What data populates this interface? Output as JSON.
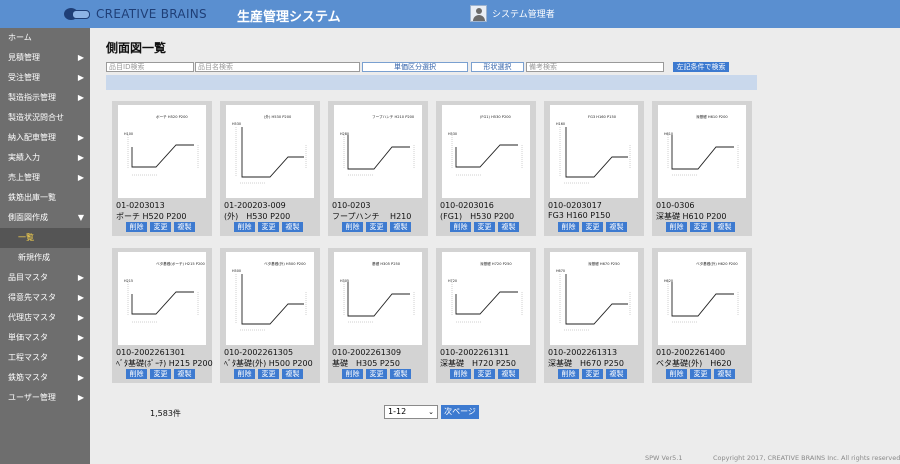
{
  "header": {
    "logo_text": "CREATIVE BRAINS",
    "system_title": "生産管理システム",
    "user_name": "システム管理者"
  },
  "sidebar": {
    "items": [
      {
        "label": "ホーム",
        "has_chevron": false
      },
      {
        "label": "見積管理",
        "has_chevron": true
      },
      {
        "label": "受注管理",
        "has_chevron": true
      },
      {
        "label": "製造指示管理",
        "has_chevron": true
      },
      {
        "label": "製造状況問合せ",
        "has_chevron": false
      },
      {
        "label": "納入配車管理",
        "has_chevron": true
      },
      {
        "label": "実績入力",
        "has_chevron": true
      },
      {
        "label": "売上管理",
        "has_chevron": true
      },
      {
        "label": "鉄筋出庫一覧",
        "has_chevron": false
      },
      {
        "label": "側面図作成",
        "has_chevron": true,
        "expanded": true
      },
      {
        "label": "品目マスタ",
        "has_chevron": true
      },
      {
        "label": "得意先マスタ",
        "has_chevron": true
      },
      {
        "label": "代理店マスタ",
        "has_chevron": true
      },
      {
        "label": "単価マスタ",
        "has_chevron": true
      },
      {
        "label": "工程マスタ",
        "has_chevron": true
      },
      {
        "label": "鉄筋マスタ",
        "has_chevron": true
      },
      {
        "label": "ユーザー管理",
        "has_chevron": true
      }
    ],
    "subitems": [
      {
        "label": "一覧",
        "active": true
      },
      {
        "label": "新規作成",
        "active": false
      }
    ],
    "chevron_right": "▶",
    "chevron_down": "▼"
  },
  "main": {
    "title": "側面図一覧",
    "filters": {
      "item_id_placeholder": "品目ID検索",
      "item_name_placeholder": "品目名検索",
      "unit_class_button": "単価区分選択",
      "shape_button": "形状選択",
      "remarks_placeholder": "備考検索",
      "search_button": "左記条件で検索"
    },
    "card_buttons": {
      "delete": "削除",
      "edit": "変更",
      "copy": "複製"
    },
    "cards": [
      {
        "code": "01-0203013",
        "name": "ポーチ H520 P200",
        "drawing_title": "ポーチ H520 P200",
        "h_label": "H100"
      },
      {
        "code": "01-200203-009",
        "name": "(外)　H530 P200",
        "drawing_title": "(外)  H530 P200",
        "h_label": "H530"
      },
      {
        "code": "010-0203",
        "name": "フープハンチ　 H210",
        "drawing_title": "フープハンチ  H210 P200",
        "h_label": "H280"
      },
      {
        "code": "010-0203016",
        "name": "(FG1)　H530 P200",
        "drawing_title": "(FG1)  H530 P200",
        "h_label": "H530"
      },
      {
        "code": "010-0203017",
        "name": "FG3 H160 P150",
        "drawing_title": "FG3 H160 P150",
        "h_label": "H160"
      },
      {
        "code": "010-0306",
        "name": "深基礎 H610 P200",
        "drawing_title": "深基礎 H610 P200",
        "h_label": "H610"
      },
      {
        "code": "010-2002261301",
        "name": "ﾍﾞﾀ基礎(ﾎﾟｰﾁ) H215 P200",
        "drawing_title": "ベタ基礎(ポーチ) H215 P200",
        "h_label": "H215"
      },
      {
        "code": "010-2002261305",
        "name": "ﾍﾞﾀ基礎(外) H500 P200",
        "drawing_title": "ベタ基礎(外) H500 P200",
        "h_label": "H500"
      },
      {
        "code": "010-2002261309",
        "name": "基礎　H305 P250",
        "drawing_title": "基礎  H305 P250",
        "h_label": "H305"
      },
      {
        "code": "010-2002261311",
        "name": "深基礎　H720 P250",
        "drawing_title": "深基礎  H720 P250",
        "h_label": "H720"
      },
      {
        "code": "010-2002261313",
        "name": "深基礎　H670 P250",
        "drawing_title": "深基礎  H670 P250",
        "h_label": "H670"
      },
      {
        "code": "010-2002261400",
        "name": "ベタ基礎(外)　H620",
        "drawing_title": "ベタ基礎(外)  H620 P200",
        "h_label": "H620"
      }
    ],
    "count": "1,583件",
    "pager": {
      "selected": "1-12",
      "caret": "⌄",
      "next": "次ページ"
    },
    "footer": {
      "version": "SPW Ver5.1",
      "copyright": "Copyright 2017, CREATIVE BRAINS Inc. All rights reserved."
    }
  }
}
